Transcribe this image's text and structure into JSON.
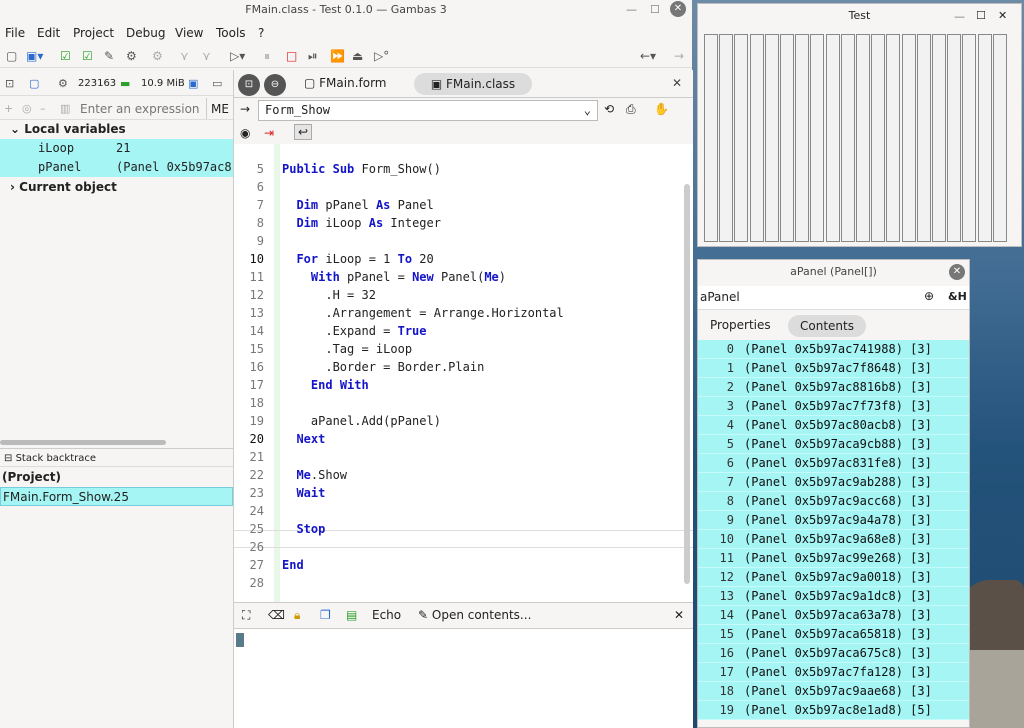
{
  "main_window": {
    "title": "FMain.class - Test 0.1.0 — Gambas 3",
    "menu": [
      "File",
      "Edit",
      "Project",
      "Debug",
      "View",
      "Tools",
      "?"
    ]
  },
  "debug_panel": {
    "process_id": "223163",
    "memory": "10.9 MiB",
    "expression_placeholder": "Enter an expression",
    "me_label": "ME",
    "local_vars_header": "Local variables",
    "locals": [
      {
        "name": "iLoop",
        "value": "21"
      },
      {
        "name": "pPanel",
        "value": "(Panel 0x5b97ac8"
      }
    ],
    "current_object_header": "Current object",
    "stack_header": "Stack backtrace",
    "stack": [
      "(Project)",
      "FMain.Form_Show.25"
    ]
  },
  "editor": {
    "tabs": [
      "FMain.form",
      "FMain.class"
    ],
    "procedure": "Form_Show",
    "lines": [
      {
        "n": "5",
        "t": "Public Sub Form_Show()"
      },
      {
        "n": "6",
        "t": ""
      },
      {
        "n": "7",
        "t": "  Dim pPanel As Panel"
      },
      {
        "n": "8",
        "t": "  Dim iLoop As Integer"
      },
      {
        "n": "9",
        "t": ""
      },
      {
        "n": "10",
        "t": "  For iLoop = 1 To 20"
      },
      {
        "n": "11",
        "t": "    With pPanel = New Panel(Me)"
      },
      {
        "n": "12",
        "t": "      .H = 32"
      },
      {
        "n": "13",
        "t": "      .Arrangement = Arrange.Horizontal"
      },
      {
        "n": "14",
        "t": "      .Expand = True"
      },
      {
        "n": "15",
        "t": "      .Tag = iLoop"
      },
      {
        "n": "16",
        "t": "      .Border = Border.Plain"
      },
      {
        "n": "17",
        "t": "    End With"
      },
      {
        "n": "18",
        "t": ""
      },
      {
        "n": "19",
        "t": "    aPanel.Add(pPanel)"
      },
      {
        "n": "20",
        "t": "  Next"
      },
      {
        "n": "21",
        "t": ""
      },
      {
        "n": "22",
        "t": "  Me.Show"
      },
      {
        "n": "23",
        "t": "  Wait"
      },
      {
        "n": "24",
        "t": ""
      },
      {
        "n": "25",
        "t": "  Stop"
      },
      {
        "n": "26",
        "t": ""
      },
      {
        "n": "27",
        "t": "End"
      },
      {
        "n": "28",
        "t": ""
      }
    ],
    "console_echo": "Echo",
    "console_open": "Open contents..."
  },
  "test_window": {
    "title": "Test"
  },
  "apanel_window": {
    "title": "aPanel (Panel[])",
    "search": "aPanel",
    "hex_btn": "&H",
    "tab_properties": "Properties",
    "tab_contents": "Contents",
    "items": [
      {
        "i": "0",
        "v": "(Panel 0x5b97ac741988) [3]"
      },
      {
        "i": "1",
        "v": "(Panel 0x5b97ac7f8648) [3]"
      },
      {
        "i": "2",
        "v": "(Panel 0x5b97ac8816b8) [3]"
      },
      {
        "i": "3",
        "v": "(Panel 0x5b97ac7f73f8) [3]"
      },
      {
        "i": "4",
        "v": "(Panel 0x5b97ac80acb8) [3]"
      },
      {
        "i": "5",
        "v": "(Panel 0x5b97aca9cb88) [3]"
      },
      {
        "i": "6",
        "v": "(Panel 0x5b97ac831fe8) [3]"
      },
      {
        "i": "7",
        "v": "(Panel 0x5b97ac9ab288) [3]"
      },
      {
        "i": "8",
        "v": "(Panel 0x5b97ac9acc68) [3]"
      },
      {
        "i": "9",
        "v": "(Panel 0x5b97ac9a4a78) [3]"
      },
      {
        "i": "10",
        "v": "(Panel 0x5b97ac9a68e8) [3]"
      },
      {
        "i": "11",
        "v": "(Panel 0x5b97ac99e268) [3]"
      },
      {
        "i": "12",
        "v": "(Panel 0x5b97ac9a0018) [3]"
      },
      {
        "i": "13",
        "v": "(Panel 0x5b97ac9a1dc8) [3]"
      },
      {
        "i": "14",
        "v": "(Panel 0x5b97aca63a78) [3]"
      },
      {
        "i": "15",
        "v": "(Panel 0x5b97aca65818) [3]"
      },
      {
        "i": "16",
        "v": "(Panel 0x5b97aca675c8) [3]"
      },
      {
        "i": "17",
        "v": "(Panel 0x5b97ac7fa128) [3]"
      },
      {
        "i": "18",
        "v": "(Panel 0x5b97ac9aae68) [3]"
      },
      {
        "i": "19",
        "v": "(Panel 0x5b97ac8e1ad8) [5]"
      }
    ]
  }
}
